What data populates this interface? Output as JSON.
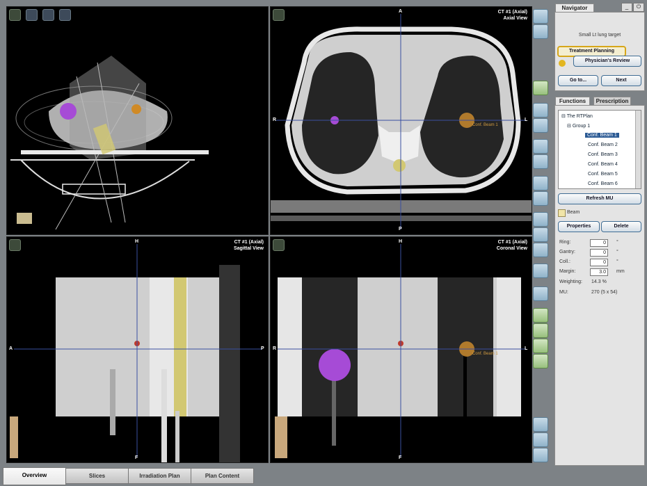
{
  "top_left_view": {
    "tools": [
      "zoom-icon",
      "rotate-icon",
      "pan-icon",
      "camera-icon"
    ]
  },
  "axial_view": {
    "title_line1": "CT #1 (Axial)",
    "title_line2": "Axial View",
    "orient_top": "A",
    "orient_bottom": "P",
    "orient_left": "R",
    "orient_right": "L",
    "target_label": "Conf. Beam 1"
  },
  "sagittal_view": {
    "title_line1": "CT #1 (Axial)",
    "title_line2": "Sagittal View",
    "orient_top": "H",
    "orient_bottom": "F",
    "orient_left": "A",
    "orient_right": "P"
  },
  "coronal_view": {
    "title_line1": "CT #1 (Axial)",
    "title_line2": "Coronal View",
    "orient_top": "H",
    "orient_bottom": "F",
    "orient_left": "R",
    "orient_right": "L",
    "target_label": "Conf. Beam 1"
  },
  "navigator": {
    "tab": "Navigator",
    "plan_name": "Small Lt lung target",
    "steps": [
      "Treatment Planning",
      "Physician's Review"
    ],
    "goto_label": "Go to...",
    "next_label": "Next"
  },
  "functions": {
    "tabs": [
      "Functions",
      "Prescription"
    ],
    "tree": {
      "root": "The RTPlan",
      "group": "Group 1",
      "beams": [
        "Conf. Beam 1",
        "Conf. Beam 2",
        "Conf. Beam 3",
        "Conf. Beam 4",
        "Conf. Beam 5",
        "Conf. Beam 6"
      ]
    },
    "refresh_label": "Refresh MU",
    "section_label": "Beam",
    "properties_label": "Properties",
    "delete_label": "Delete"
  },
  "beam_params": {
    "ring_label": "Ring:",
    "ring_value": "0",
    "ring_unit": "°",
    "gantry_label": "Gantry:",
    "gantry_value": "0",
    "gantry_unit": "°",
    "coll_label": "Coll.:",
    "coll_value": "0",
    "coll_unit": "°",
    "margin_label": "Margin:",
    "margin_value": "3.0",
    "margin_unit": "mm",
    "weighting_label": "Weighting:",
    "weighting_value": "14.3 %",
    "mu_label": "MU:",
    "mu_value": "270 (5 x 54)"
  },
  "bottom_tabs": [
    "Overview",
    "Slices",
    "Irradiation Plan",
    "Plan Content"
  ],
  "colors": {
    "accent": "#2b5a94",
    "target_purple": "#a64bd6",
    "target_orange": "#c98a2e",
    "crosshair": "#3a4fa0"
  }
}
